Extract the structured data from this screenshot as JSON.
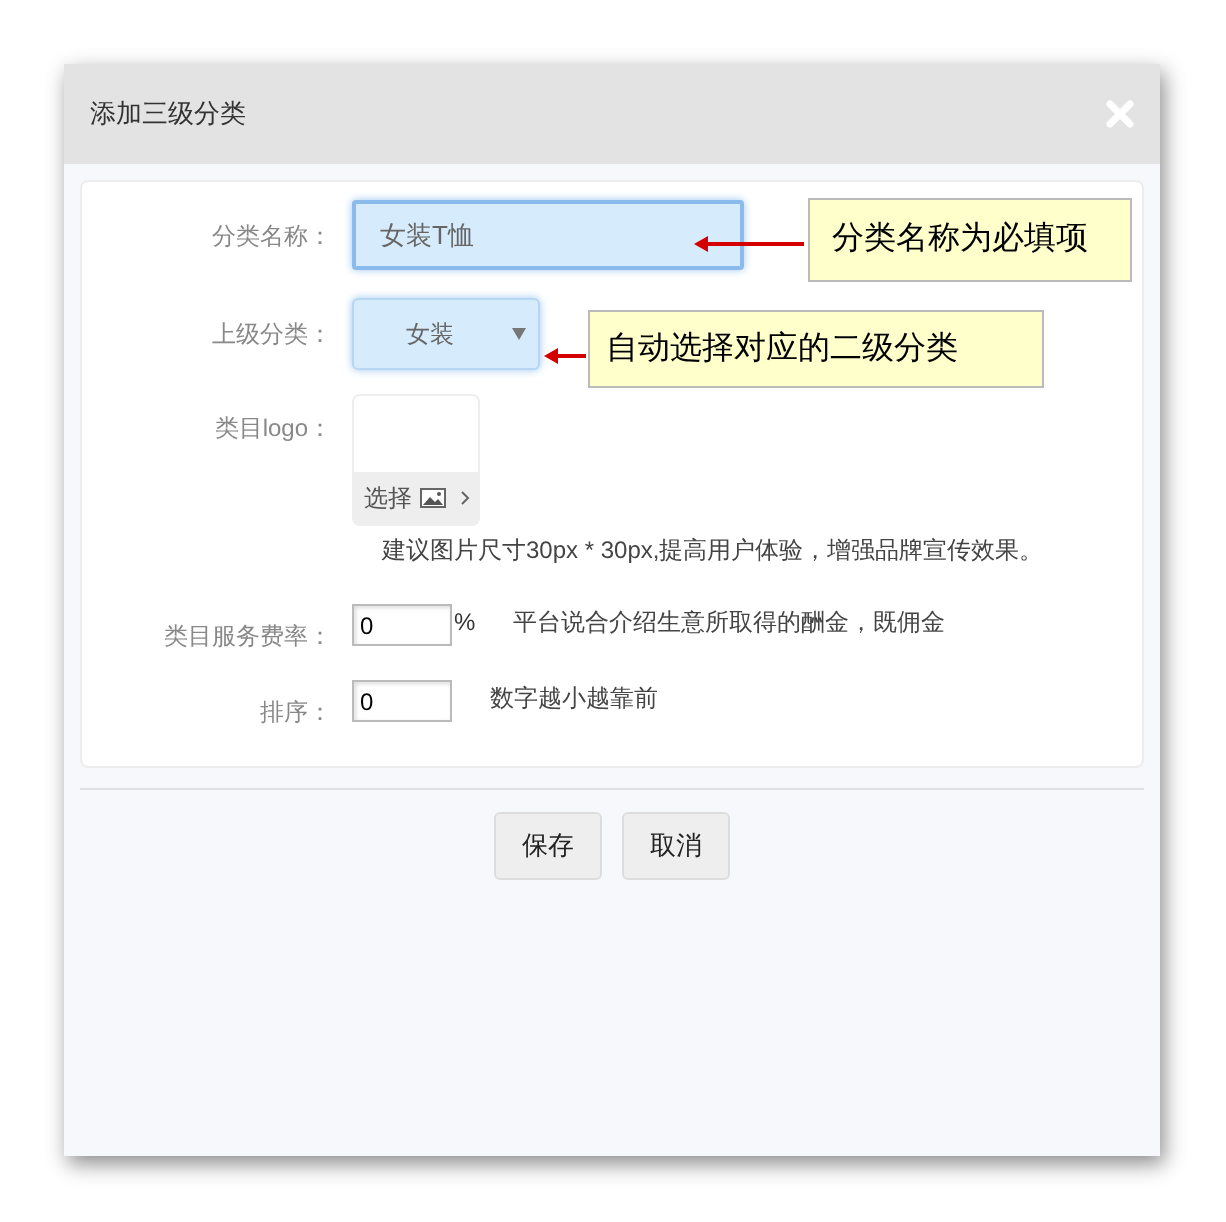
{
  "dialog": {
    "title": "添加三级分类"
  },
  "fields": [
    {
      "kind": "text",
      "label": "分类名称：",
      "value": "女装T恤",
      "focused": true
    },
    {
      "kind": "select",
      "label": "上级分类：",
      "value": "女装",
      "focused": true
    },
    {
      "kind": "image",
      "label": "类目logo：",
      "button": "选择",
      "hint": "建议图片尺寸30px * 30px,提高用户体验，增强品牌宣传效果。"
    },
    {
      "kind": "number",
      "label": "类目服务费率：",
      "value": "0",
      "unit": "%",
      "hint": "平台说合介绍生意所取得的酬金，既佣金"
    },
    {
      "kind": "number",
      "label": "排序：",
      "value": "0",
      "hint": "数字越小越靠前"
    }
  ],
  "buttons": [
    "保存",
    "取消"
  ],
  "annotations": [
    "分类名称为必填项",
    "自动选择对应的二级分类"
  ]
}
